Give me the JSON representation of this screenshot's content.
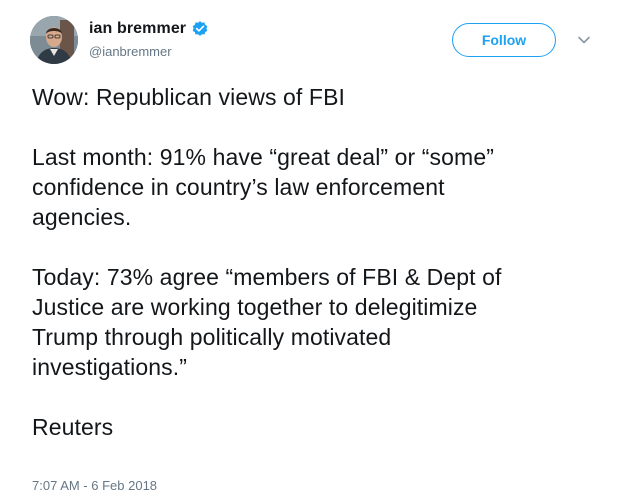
{
  "author": {
    "display_name": "ian bremmer",
    "handle": "@ianbremmer",
    "verified": true,
    "avatar_icon": "profile-photo"
  },
  "actions": {
    "follow_label": "Follow",
    "more_icon": "chevron-down-icon"
  },
  "tweet": {
    "paragraphs": [
      "Wow: Republican views of FBI",
      "Last month: 91% have “great deal” or “some”\nconfidence in country’s law enforcement\nagencies.",
      "Today: 73% agree “members of FBI & Dept of\nJustice are working together to delegitimize\nTrump through politically motivated\ninvestigations.”",
      "Reuters"
    ]
  },
  "meta": {
    "timestamp": "7:07 AM - 6 Feb 2018"
  },
  "colors": {
    "accent": "#1da1f2",
    "text": "#14171a",
    "secondary": "#657786"
  }
}
